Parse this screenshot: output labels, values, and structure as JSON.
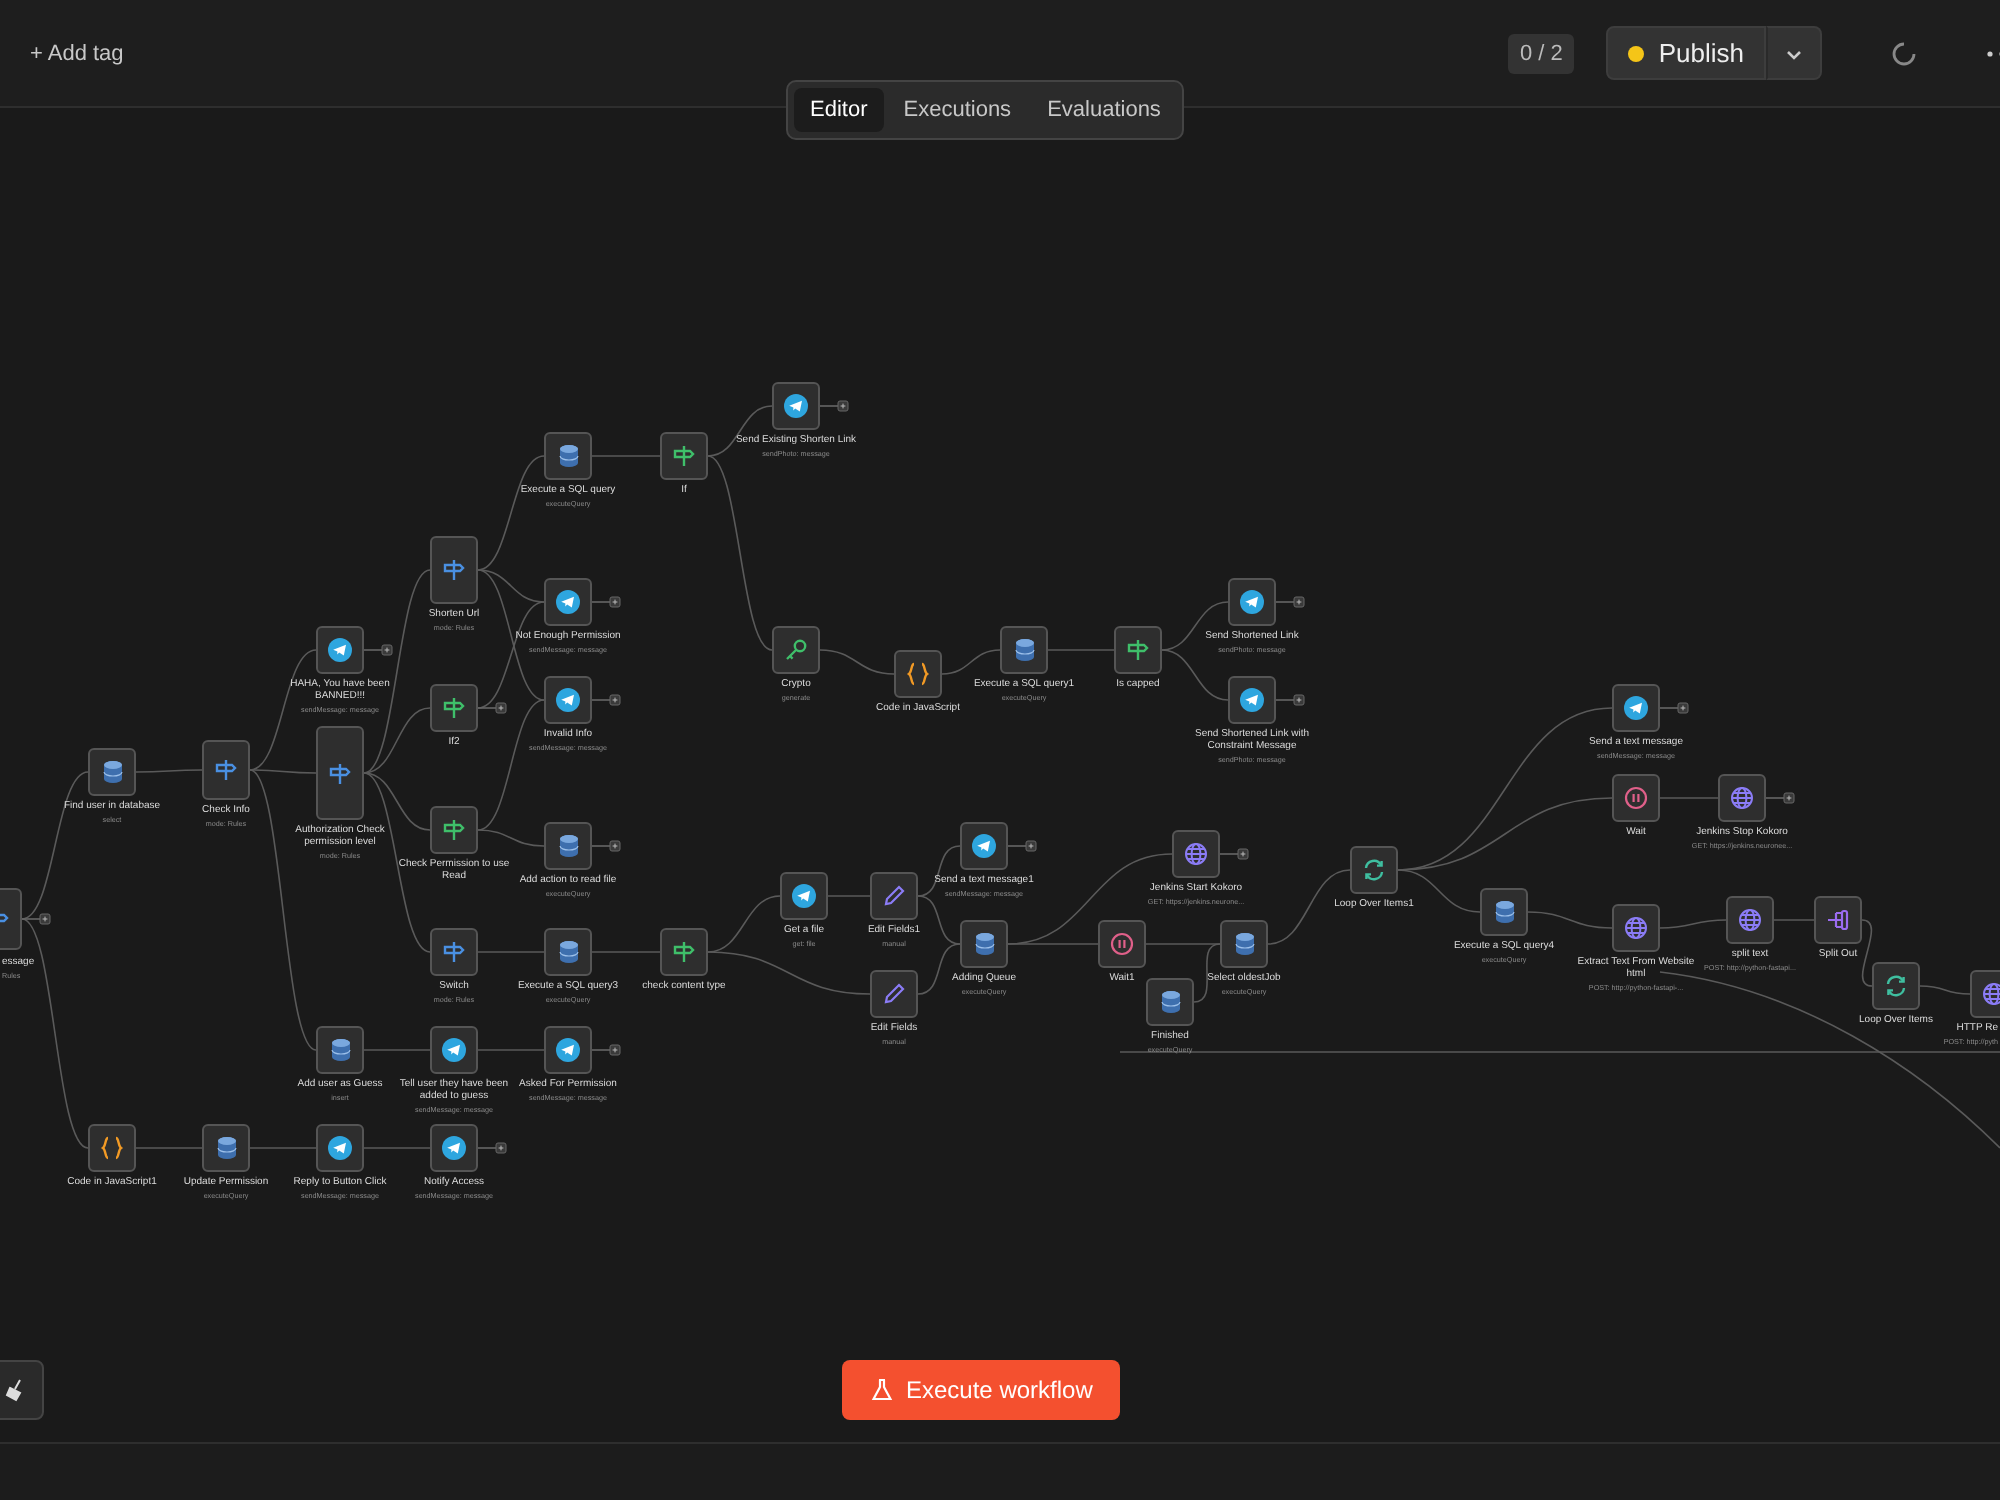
{
  "header": {
    "add_tag": "+ Add tag",
    "counter": "0 / 2",
    "publish": {
      "label": "Publish",
      "unpublished": true
    }
  },
  "tabs": [
    {
      "label": "Editor",
      "selected": true
    },
    {
      "label": "Executions",
      "selected": false
    },
    {
      "label": "Evaluations",
      "selected": false
    }
  ],
  "nodes": [
    {
      "title": "essage",
      "subtitle": "Rules",
      "kind": "switch",
      "end_handle": true
    },
    {
      "title": "Find user in database",
      "subtitle": "select",
      "kind": "postgres",
      "end_handle": false
    },
    {
      "title": "Check Info",
      "subtitle": "mode: Rules",
      "kind": "switch",
      "end_handle": false
    },
    {
      "title": "HAHA, You have been BANNED!!!",
      "subtitle": "sendMessage: message",
      "kind": "telegram",
      "end_handle": true
    },
    {
      "title": "Authorization Check permission level",
      "subtitle": "mode: Rules",
      "kind": "switch",
      "end_handle": false
    },
    {
      "title": "Shorten Url",
      "subtitle": "mode: Rules",
      "kind": "switch",
      "end_handle": false
    },
    {
      "title": "If2",
      "kind": "if",
      "end_handle": true
    },
    {
      "title": "Check Permission to use Read",
      "kind": "if",
      "end_handle": false
    },
    {
      "title": "Switch",
      "subtitle": "mode: Rules",
      "kind": "switch",
      "end_handle": false
    },
    {
      "title": "Add user as Guess",
      "subtitle": "insert",
      "kind": "postgres",
      "end_handle": false
    },
    {
      "title": "Code in JavaScript1",
      "kind": "code",
      "end_handle": false
    },
    {
      "title": "Update Permission",
      "subtitle": "executeQuery",
      "kind": "postgres",
      "end_handle": false
    },
    {
      "title": "Reply to Button Click",
      "subtitle": "sendMessage: message",
      "kind": "telegram",
      "end_handle": false
    },
    {
      "title": "Notify Access",
      "subtitle": "sendMessage: message",
      "kind": "telegram",
      "end_handle": true
    },
    {
      "title": "Execute a SQL query",
      "subtitle": "executeQuery",
      "kind": "postgres",
      "end_handle": false
    },
    {
      "title": "Not Enough Permission",
      "subtitle": "sendMessage: message",
      "kind": "telegram",
      "end_handle": true
    },
    {
      "title": "Invalid Info",
      "subtitle": "sendMessage: message",
      "kind": "telegram",
      "end_handle": true
    },
    {
      "title": "Add action to read file",
      "subtitle": "executeQuery",
      "kind": "postgres",
      "end_handle": true
    },
    {
      "title": "Execute a SQL query3",
      "subtitle": "executeQuery",
      "kind": "postgres",
      "end_handle": false
    },
    {
      "title": "Tell user they have been added to guess",
      "subtitle": "sendMessage: message",
      "kind": "telegram",
      "end_handle": false
    },
    {
      "title": "Asked For Permission",
      "subtitle": "sendMessage: message",
      "kind": "telegram",
      "end_handle": true
    },
    {
      "title": "If",
      "kind": "if",
      "end_handle": false
    },
    {
      "title": "check content type",
      "kind": "if",
      "end_handle": false
    },
    {
      "title": "Send Existing Shorten Link",
      "subtitle": "sendPhoto: message",
      "kind": "telegram",
      "end_handle": true
    },
    {
      "title": "Crypto",
      "subtitle": "generate",
      "kind": "crypto",
      "end_handle": false
    },
    {
      "title": "Code in JavaScript",
      "kind": "code",
      "end_handle": false
    },
    {
      "title": "Execute a SQL query1",
      "subtitle": "executeQuery",
      "kind": "postgres",
      "end_handle": false
    },
    {
      "title": "Is capped",
      "kind": "if",
      "end_handle": false
    },
    {
      "title": "Send Shortened Link",
      "subtitle": "sendPhoto: message",
      "kind": "telegram",
      "end_handle": true
    },
    {
      "title": "Send Shortened Link with Constraint Message",
      "subtitle": "sendPhoto: message",
      "kind": "telegram",
      "end_handle": true
    },
    {
      "title": "Get a file",
      "subtitle": "get: file",
      "kind": "telegram",
      "end_handle": false
    },
    {
      "title": "Edit Fields1",
      "subtitle": "manual",
      "kind": "edit",
      "end_handle": false
    },
    {
      "title": "Edit Fields",
      "subtitle": "manual",
      "kind": "edit",
      "end_handle": false
    },
    {
      "title": "Send a text message1",
      "subtitle": "sendMessage: message",
      "kind": "telegram",
      "end_handle": true
    },
    {
      "title": "Adding Queue",
      "subtitle": "executeQuery",
      "kind": "postgres",
      "end_handle": false
    },
    {
      "title": "Jenkins Start Kokoro",
      "subtitle": "GET: https://jenkins.neurone...",
      "kind": "http",
      "end_handle": true
    },
    {
      "title": "Wait1",
      "kind": "wait",
      "end_handle": false
    },
    {
      "title": "Select oldestJob",
      "subtitle": "executeQuery",
      "kind": "postgres",
      "end_handle": false
    },
    {
      "title": "Finished",
      "subtitle": "executeQuery",
      "kind": "postgres",
      "end_handle": false
    },
    {
      "title": "Loop Over Items1",
      "kind": "loop",
      "end_handle": false
    },
    {
      "title": "Send a text message",
      "subtitle": "sendMessage: message",
      "kind": "telegram",
      "end_handle": true
    },
    {
      "title": "Wait",
      "kind": "wait",
      "end_handle": false
    },
    {
      "title": "Jenkins Stop Kokoro",
      "subtitle": "GET: https://jenkins.neuronee...",
      "kind": "http",
      "end_handle": true
    },
    {
      "title": "Execute a SQL query4",
      "subtitle": "executeQuery",
      "kind": "postgres",
      "end_handle": false
    },
    {
      "title": "Extract Text From Website html",
      "subtitle": "POST: http://python-fastapi-...",
      "kind": "http",
      "end_handle": false
    },
    {
      "title": "split text",
      "subtitle": "POST: http://python-fastapi...",
      "kind": "http",
      "end_handle": false
    },
    {
      "title": "Split Out",
      "kind": "split",
      "end_handle": false
    },
    {
      "title": "Loop Over Items",
      "kind": "loop",
      "end_handle": false
    },
    {
      "title": "HTTP Re",
      "subtitle": "POST: http://pyth",
      "kind": "http",
      "end_handle": false
    }
  ],
  "execute_button": "Execute workflow"
}
